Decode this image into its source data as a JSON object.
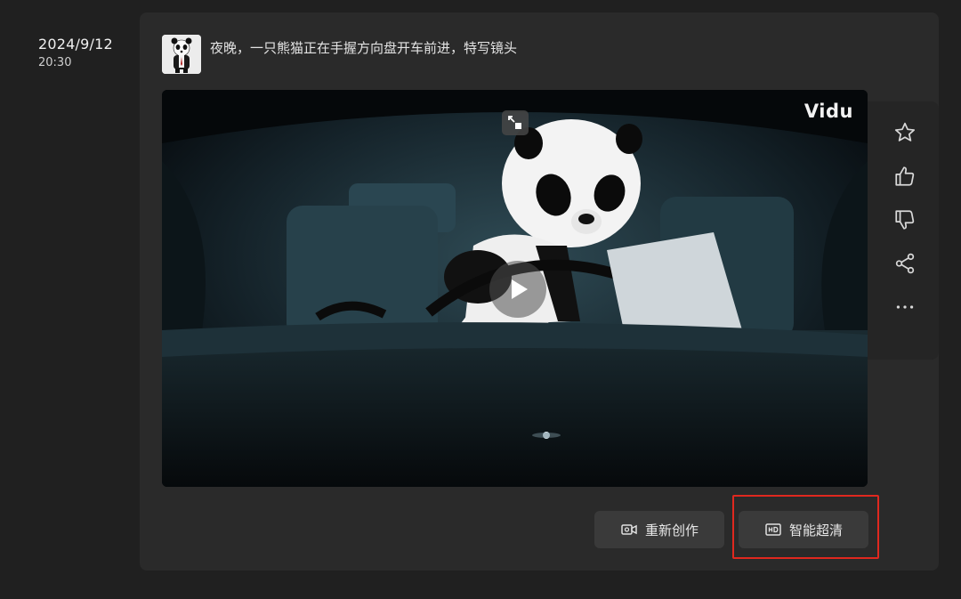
{
  "meta": {
    "date": "2024/9/12",
    "time": "20:30"
  },
  "prompt": {
    "text": "夜晚，一只熊猫正在手握方向盘开车前进，特写镜头",
    "avatar_icon": "panda-avatar"
  },
  "video": {
    "watermark": "Vidu",
    "pip_icon": "picture-in-picture-icon",
    "play_icon": "play-icon"
  },
  "actions": [
    {
      "icon": "star-icon"
    },
    {
      "icon": "thumbs-up-icon"
    },
    {
      "icon": "thumbs-down-icon"
    },
    {
      "icon": "share-icon"
    },
    {
      "icon": "more-icon"
    }
  ],
  "buttons": {
    "recreate_label": "重新创作",
    "hd_label": "智能超清"
  },
  "colors": {
    "background": "#202020",
    "card": "#2a2a2a",
    "button": "#3a3a3a",
    "highlight": "#e0281f"
  }
}
